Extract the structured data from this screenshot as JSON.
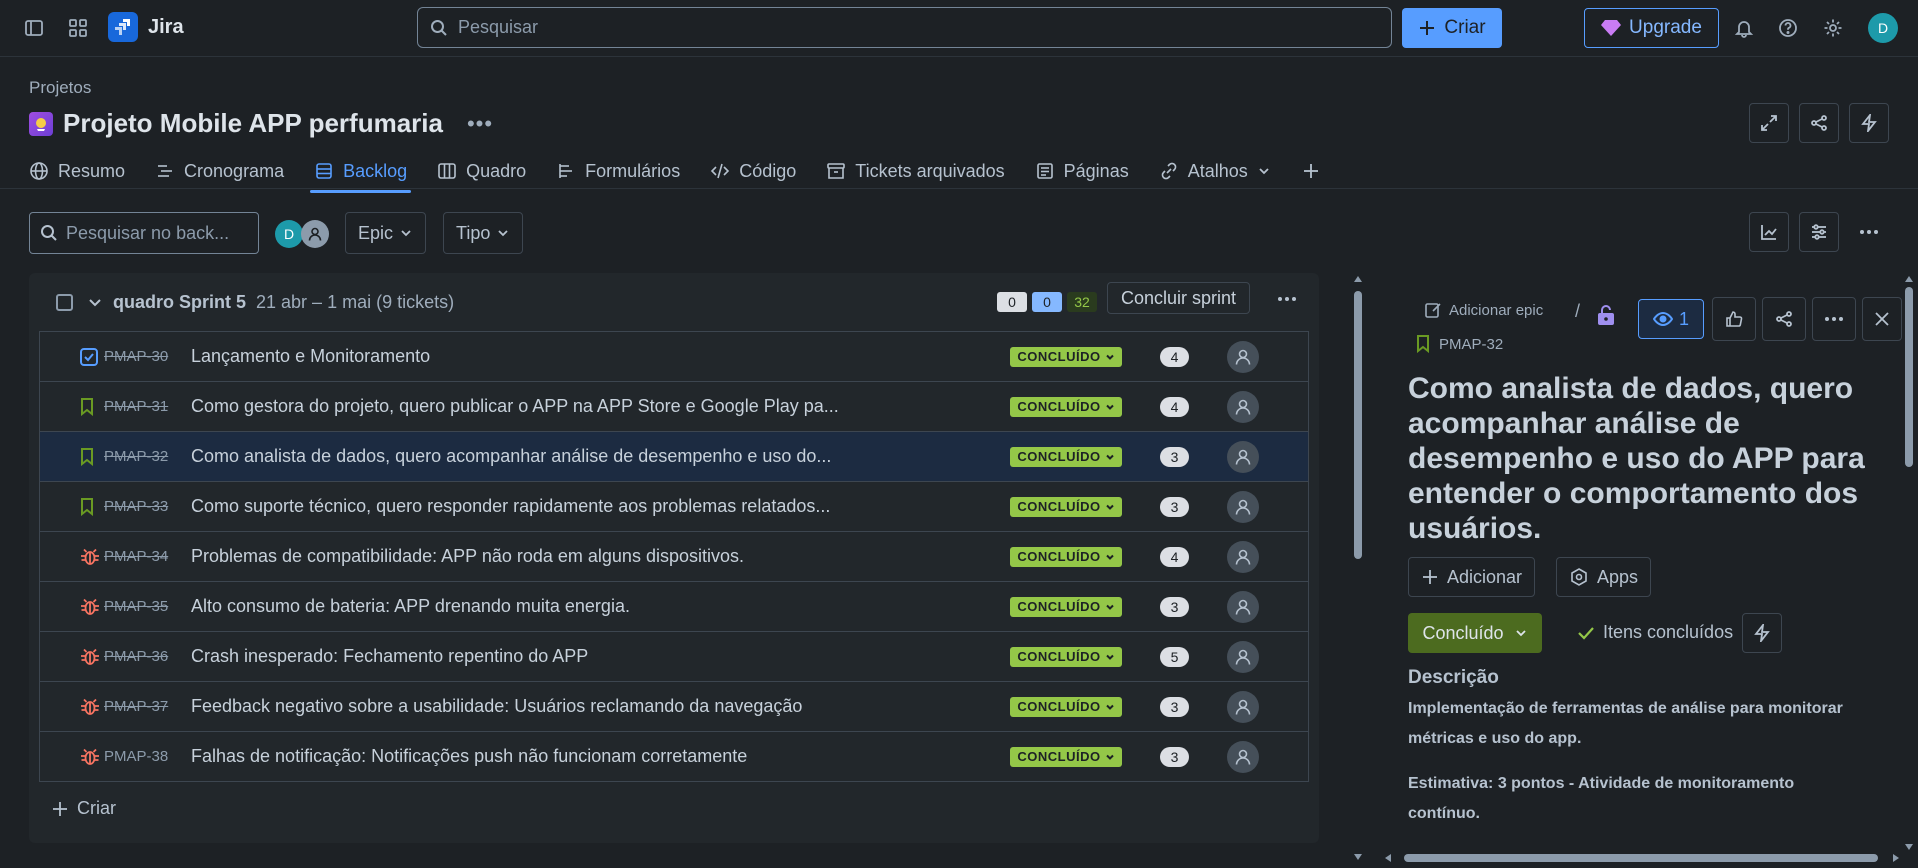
{
  "topbar": {
    "app_name": "Jira",
    "search_placeholder": "Pesquisar",
    "create_label": "Criar",
    "upgrade_label": "Upgrade",
    "avatar_initial": "D"
  },
  "project": {
    "breadcrumb": "Projetos",
    "name": "Projeto Mobile APP perfumaria",
    "tabs": [
      {
        "label": "Resumo",
        "icon": "globe-icon"
      },
      {
        "label": "Cronograma",
        "icon": "timeline-icon"
      },
      {
        "label": "Backlog",
        "icon": "backlog-icon"
      },
      {
        "label": "Quadro",
        "icon": "board-icon"
      },
      {
        "label": "Formulários",
        "icon": "forms-icon"
      },
      {
        "label": "Código",
        "icon": "code-icon"
      },
      {
        "label": "Tickets arquivados",
        "icon": "archive-icon"
      },
      {
        "label": "Páginas",
        "icon": "pages-icon"
      },
      {
        "label": "Atalhos",
        "icon": "link-icon"
      }
    ],
    "active_tab": "Backlog"
  },
  "filters": {
    "search_placeholder": "Pesquisar no back...",
    "avatar_initial": "D",
    "epic_label": "Epic",
    "type_label": "Tipo"
  },
  "sprint": {
    "name": "quadro Sprint 5",
    "dates": "21 abr – 1 mai (9 tickets)",
    "counts": {
      "todo": "0",
      "in_progress": "0",
      "done": "32"
    },
    "complete_label": "Concluir sprint",
    "add_label": "Criar",
    "issues": [
      {
        "key": "PMAP-30",
        "summary": "Lançamento e Monitoramento",
        "type": "task",
        "status": "CONCLUÍDO",
        "points": "4",
        "strike": true
      },
      {
        "key": "PMAP-31",
        "summary": "Como gestora do projeto, quero publicar o APP na APP Store e Google Play pa...",
        "type": "story",
        "status": "CONCLUÍDO",
        "points": "4",
        "strike": true
      },
      {
        "key": "PMAP-32",
        "summary": "Como analista de dados, quero acompanhar análise de desempenho e uso do...",
        "type": "story",
        "status": "CONCLUÍDO",
        "points": "3",
        "strike": true,
        "selected": true
      },
      {
        "key": "PMAP-33",
        "summary": "Como suporte técnico, quero responder rapidamente aos problemas relatados...",
        "type": "story",
        "status": "CONCLUÍDO",
        "points": "3",
        "strike": true
      },
      {
        "key": "PMAP-34",
        "summary": "Problemas de compatibilidade: APP não roda em alguns dispositivos.",
        "type": "bug",
        "status": "CONCLUÍDO",
        "points": "4",
        "strike": true
      },
      {
        "key": "PMAP-35",
        "summary": "Alto consumo de bateria: APP drenando muita energia.",
        "type": "bug",
        "status": "CONCLUÍDO",
        "points": "3",
        "strike": true
      },
      {
        "key": "PMAP-36",
        "summary": "Crash inesperado: Fechamento repentino do APP",
        "type": "bug",
        "status": "CONCLUÍDO",
        "points": "5",
        "strike": true
      },
      {
        "key": "PMAP-37",
        "summary": "Feedback negativo sobre a usabilidade: Usuários reclamando da navegação",
        "type": "bug",
        "status": "CONCLUÍDO",
        "points": "3",
        "strike": true
      },
      {
        "key": "PMAP-38",
        "summary": "Falhas de notificação: Notificações push não funcionam corretamente",
        "type": "bug",
        "status": "CONCLUÍDO",
        "points": "3",
        "strike": false
      }
    ]
  },
  "detail": {
    "add_epic_label": "Adicionar epic",
    "breadcrumb_sep": "/",
    "watch_count": "1",
    "issue_key": "PMAP-32",
    "title": "Como analista de dados, quero acompanhar análise de desempenho e uso do APP para entender o comportamento dos usuários.",
    "add_label": "Adicionar",
    "apps_label": "Apps",
    "status_label": "Concluído",
    "done_items_label": "Itens concluídos",
    "description_heading": "Descrição",
    "description_p1": "Implementação de ferramentas de análise para monitorar métricas e uso do app.",
    "description_p2": "Estimativa: 3 pontos - Atividade de monitoramento contínuo."
  },
  "colors": {
    "background": "#1d2125",
    "accent": "#579dff",
    "done_lozenge": "#94c748",
    "bug_icon": "#f87462",
    "story_icon": "#6a9a23",
    "task_icon": "#579dff"
  }
}
